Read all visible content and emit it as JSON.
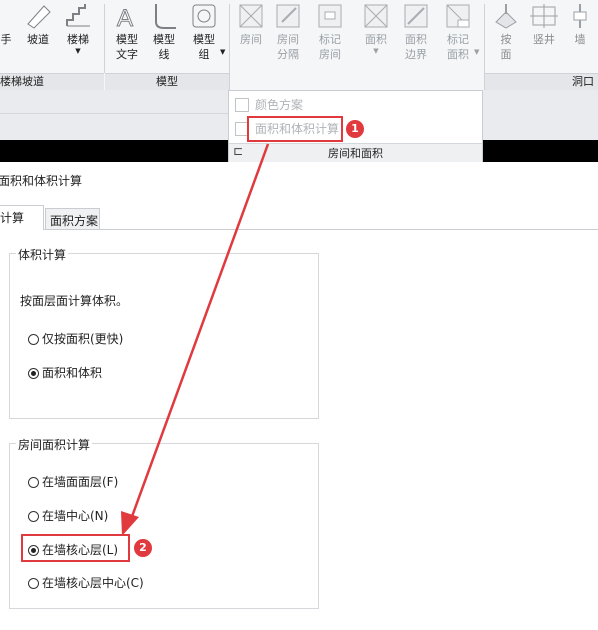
{
  "ribbon": {
    "groups": {
      "stairs_ramp": "楼梯坡道",
      "model": "模型",
      "room_area": "房间和面积",
      "opening": "洞口"
    },
    "buttons": {
      "left_partial": "手",
      "ramp": "坡道",
      "stairs": "楼梯",
      "model_text": "模型\n文字",
      "model_line": "模型\n线",
      "model_group": "模型\n组",
      "room": "房间",
      "room_separator": "房间\n分隔",
      "tag_room": "标记\n房间",
      "area": "面积",
      "area_boundary": "面积\n边界",
      "tag_area": "标记\n面积",
      "by_face": "按\n面",
      "shaft": "竖井",
      "wall": "墙"
    }
  },
  "dropdown": {
    "color_scheme": "颜色方案",
    "area_volume_calc": "面积和体积计算"
  },
  "dialog": {
    "title": "面积和体积计算",
    "tabs": [
      "计算",
      "面积方案"
    ],
    "volume_group": {
      "legend": "体积计算",
      "description": "按面层面计算体积。",
      "options": [
        "仅按面积(更快)",
        "面积和体积"
      ]
    },
    "room_area_group": {
      "legend": "房间面积计算",
      "options": [
        "在墙面面层(F)",
        "在墙中心(N)",
        "在墙核心层(L)",
        "在墙核心层中心(C)"
      ]
    }
  },
  "annotations": {
    "badge1": "1",
    "badge2": "2"
  },
  "colors": {
    "accent_red": "#e0393e",
    "ribbon_bg": "#f5f6f7"
  }
}
